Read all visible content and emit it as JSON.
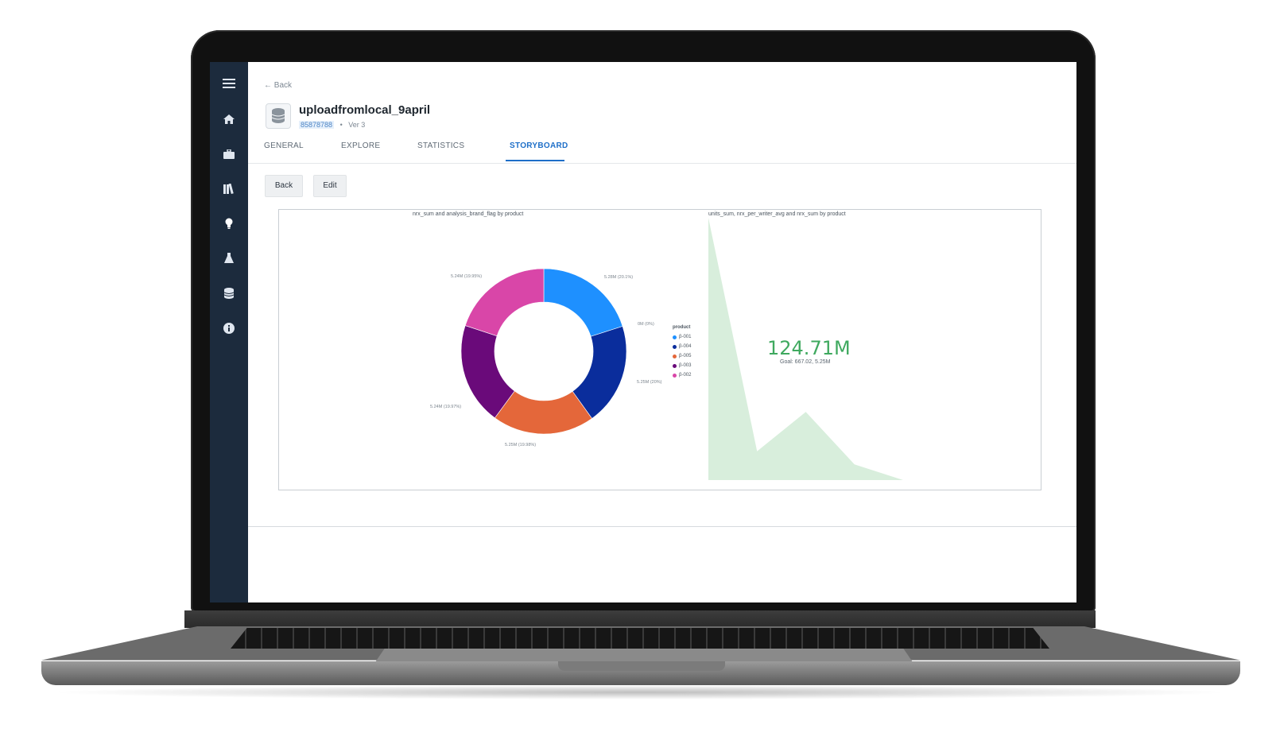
{
  "nav": {
    "items": [
      {
        "icon": "menu-icon",
        "active": false
      },
      {
        "icon": "home-icon",
        "active": false
      },
      {
        "icon": "briefcase-icon",
        "active": false
      },
      {
        "icon": "library-icon",
        "active": false
      },
      {
        "icon": "lightbulb-icon",
        "active": true
      },
      {
        "icon": "flask-icon",
        "active": false
      },
      {
        "icon": "database-icon",
        "active": false
      },
      {
        "icon": "info-icon",
        "active": false
      }
    ]
  },
  "header": {
    "back_label": "← Back",
    "dataset_icon": "database-icon",
    "title": "uploadfromlocal_9april",
    "dataset_id": "85878788",
    "separator": "•",
    "version": "Ver 3"
  },
  "tabs": [
    {
      "label": "GENERAL",
      "active": false
    },
    {
      "label": "EXPLORE",
      "active": false
    },
    {
      "label": "STATISTICS",
      "active": false
    },
    {
      "label": "STORYBOARD",
      "active": true
    }
  ],
  "toolbar": {
    "back_label": "Back",
    "edit_label": "Edit"
  },
  "colors": {
    "accent": "#1e6fc8",
    "sidebar": "#1c2b3d",
    "kpi_green": "#3fa95f",
    "area_fill": "#d8eedc"
  },
  "chart_data": [
    {
      "type": "pie",
      "variant": "donut",
      "title": "nrx_sum and analysis_brand_flag by product",
      "legend_title": "product",
      "legend_placement": "right",
      "categories": [
        "β-001",
        "β-004",
        "β-005",
        "β-003",
        "β-002"
      ],
      "values": [
        5.28,
        5.25,
        5.25,
        5.24,
        5.24
      ],
      "percent": [
        20.1,
        20,
        19.98,
        19.97,
        19.95
      ],
      "labels": [
        "5.28M (20.1%)",
        "5.25M (20%)",
        "5.25M (19.98%)",
        "5.24M (19.97%)",
        "5.24M (19.95%)"
      ],
      "zero_label": "0M (0%)",
      "colors": [
        "#1e90ff",
        "#0a2d9c",
        "#e4673a",
        "#6a0a7a",
        "#d946a8"
      ]
    },
    {
      "type": "area",
      "title": "units_sum, nrx_per_writer_avg and nrx_sum by product",
      "kpi_value": "124.71M",
      "kpi_goal": "Goal: 667.02, 5.25M",
      "x": [
        0,
        1,
        2,
        3,
        4
      ],
      "values": [
        100,
        11,
        26,
        6,
        0
      ],
      "ylim": [
        0,
        100
      ],
      "color": "#d8eedc"
    }
  ]
}
